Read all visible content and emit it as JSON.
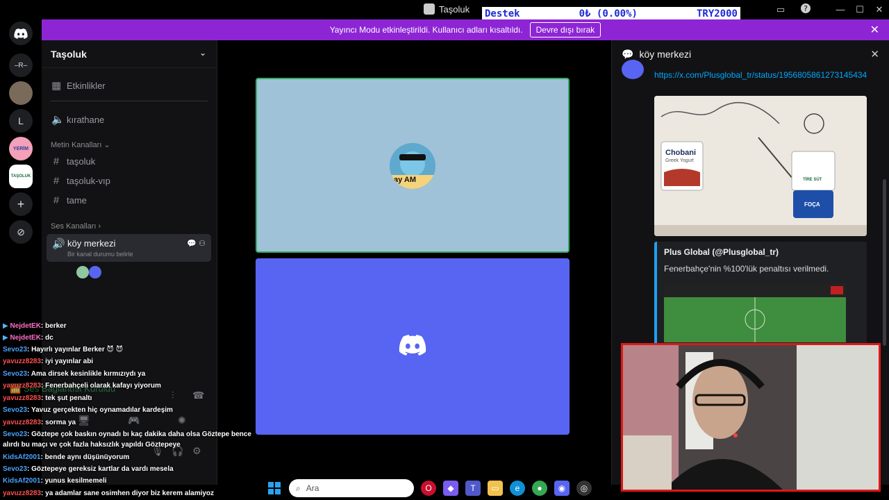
{
  "titlebar": {
    "app_title": "Taşoluk",
    "donation": {
      "label": "Destek",
      "amount": "0₺ (0.00%)",
      "goal": "TRY2000"
    }
  },
  "rail": {
    "servers": [
      {
        "name": "discord-home",
        "label": ""
      },
      {
        "name": "server-r",
        "label": "–R–"
      },
      {
        "name": "server-photo",
        "label": ""
      },
      {
        "name": "server-l",
        "label": "L"
      },
      {
        "name": "server-yerim",
        "label": "YERİM"
      },
      {
        "name": "server-tasoluk",
        "label": "TAŞOLUK"
      }
    ]
  },
  "banner": {
    "text": "Yayıncı Modu etkinleştirildi. Kullanıcı adları kısaltıldı.",
    "button": "Devre dışı bırak"
  },
  "sidebar": {
    "server_name": "Taşoluk",
    "events": "Etkinlikler",
    "kirathane": "kırathane",
    "text_category": "Metin Kanalları",
    "text_channels": [
      "taşoluk",
      "taşoluk-vıp",
      "tame"
    ],
    "voice_category": "Ses Kanalları",
    "voice_channel": "köy merkezi",
    "voice_status": "Bir kanal durumu belirle"
  },
  "voice_connection": {
    "label": "Ses Bağlantısı Kuruldu"
  },
  "stage": {
    "tile1_avatar_text": "ay AM"
  },
  "rpanel": {
    "title": "köy merkezi",
    "link": "https://x.com/Plusglobal_tr/status/1956805861273145434",
    "embed_author": "Plus Global (@Plusglobal_tr)",
    "embed_text": "Fenerbahçe'nin %100'lük penaltısı verilmedi.",
    "brand1": "Chobani",
    "brand1_sub": "Greek Yogurt",
    "brand2": "TİRE SÜT",
    "brand3": "FOÇA"
  },
  "chat": [
    {
      "user": "NejdetEK",
      "msg": ": berker",
      "color": "#ff6ec7",
      "badge": true
    },
    {
      "user": "NejdetEK",
      "msg": ": dc",
      "color": "#ff6ec7",
      "badge": true
    },
    {
      "user": "Sevo23",
      "msg": ": Hayırlı yayınlar Berker 😈 😈",
      "color": "#4aa3ff",
      "badge": false
    },
    {
      "user": "yavuzz8283",
      "msg": ": iyi yayınlar abi",
      "color": "#ff4f4f",
      "badge": false
    },
    {
      "user": "Sevo23",
      "msg": ": Ama dirsek kesinlikle kırmızıydı ya",
      "color": "#4aa3ff",
      "badge": false
    },
    {
      "user": "yavuzz8283",
      "msg": ": Fenerbahçeli olarak kafayı yiyorum",
      "color": "#ff4f4f",
      "badge": false
    },
    {
      "user": "yavuzz8283",
      "msg": ": tek şut penaltı",
      "color": "#ff4f4f",
      "badge": false
    },
    {
      "user": "Sevo23",
      "msg": ": Yavuz gerçekten hiç oynamadılar kardeşim",
      "color": "#4aa3ff",
      "badge": false
    },
    {
      "user": "yavuzz8283",
      "msg": ": sorma ya",
      "color": "#ff4f4f",
      "badge": false
    },
    {
      "user": "Sevo23",
      "msg": ": Göztepe çok baskın oynadı bı kaç dakika daha olsa Göztepe bence",
      "color": "#4aa3ff",
      "badge": false
    },
    {
      "user": "",
      "msg": "alırdı bu maçı ve çok fazla haksızlık yapıldı Göztepeye",
      "color": "#fff",
      "badge": false
    },
    {
      "user": "KidsAf2001",
      "msg": ": bende aynı düşünüyorum",
      "color": "#4aa3ff",
      "badge": false
    },
    {
      "user": "Sevo23",
      "msg": ": Göztepeye gereksiz kartlar da vardı mesela",
      "color": "#4aa3ff",
      "badge": false
    },
    {
      "user": "KidsAf2001",
      "msg": ": yunus kesilmemeli",
      "color": "#4aa3ff",
      "badge": false
    },
    {
      "user": "yavuzz8283",
      "msg": ": ya adamlar sane osimhen diyor biz kerem alamiyoz",
      "color": "#ff4f4f",
      "badge": false
    }
  ],
  "taskbar": {
    "search_placeholder": "Ara"
  }
}
